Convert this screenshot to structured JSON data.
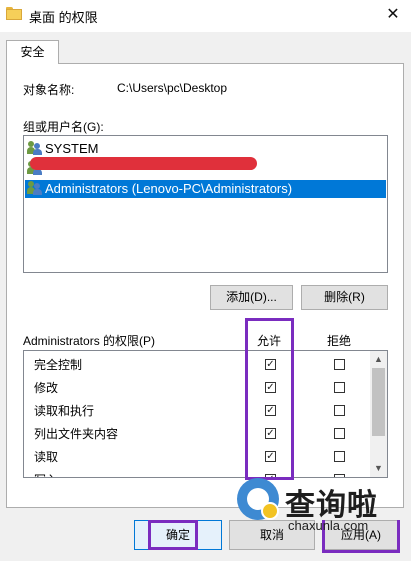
{
  "window": {
    "title": "桌面 的权限",
    "close_glyph": "✕"
  },
  "tabs": [
    {
      "label": "安全"
    }
  ],
  "object": {
    "label": "对象名称:",
    "value": "C:\\Users\\pc\\Desktop"
  },
  "groups": {
    "label": "组或用户名(G):",
    "items": [
      {
        "name": "SYSTEM",
        "icon": "users-icon"
      },
      {
        "name": "",
        "icon": "users-icon",
        "redacted": true
      },
      {
        "name": "Administrators (Lenovo-PC\\Administrators)",
        "icon": "users-icon",
        "selected": true
      }
    ]
  },
  "buttons": {
    "add": "添加(D)...",
    "remove": "删除(R)",
    "ok": "确定",
    "cancel": "取消",
    "apply": "应用(A)"
  },
  "permissions": {
    "label": "Administrators 的权限(P)",
    "allow_header": "允许",
    "deny_header": "拒绝",
    "rows": [
      {
        "name": "完全控制",
        "allow": true,
        "deny": false
      },
      {
        "name": "修改",
        "allow": true,
        "deny": false
      },
      {
        "name": "读取和执行",
        "allow": true,
        "deny": false
      },
      {
        "name": "列出文件夹内容",
        "allow": true,
        "deny": false
      },
      {
        "name": "读取",
        "allow": true,
        "deny": false
      },
      {
        "name": "写入",
        "allow": true,
        "deny": false
      }
    ]
  },
  "watermark": {
    "brand": "查询啦",
    "site": "chaxunla.com"
  },
  "colors": {
    "selection": "#0078d7",
    "highlight": "#7a2cbf",
    "redaction": "#e0303b"
  }
}
